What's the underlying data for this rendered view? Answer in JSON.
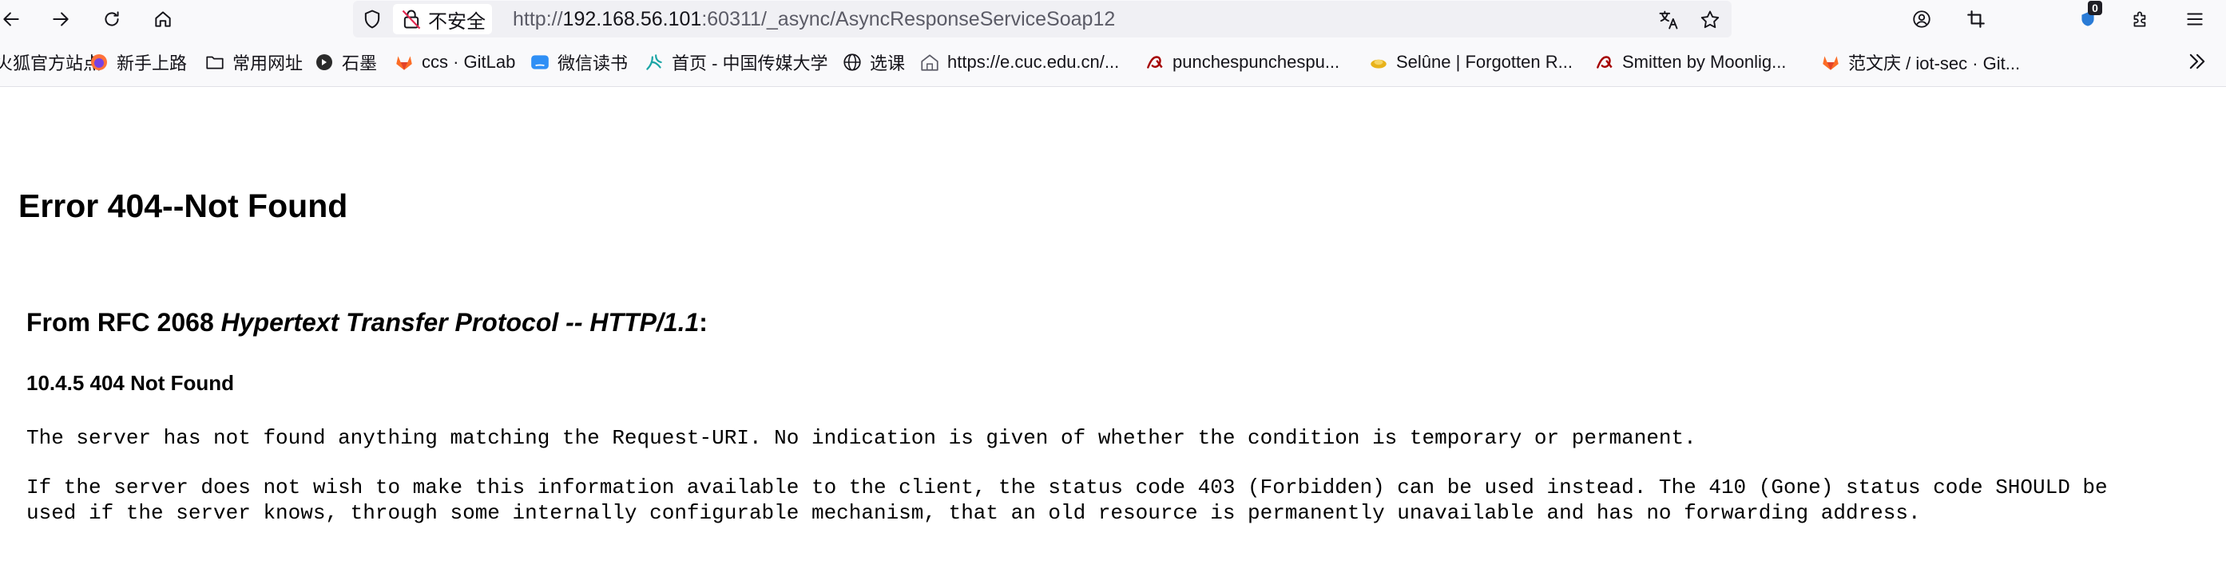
{
  "toolbar": {
    "back_icon": "arrow-left-icon",
    "forward_icon": "arrow-right-icon",
    "reload_icon": "reload-icon",
    "home_icon": "home-icon",
    "security_label": "不安全",
    "url_prefix": "http://",
    "url_host": "192.168.56.101",
    "url_rest": ":60311/_async/AsyncResponseServiceSoap12",
    "translate_icon": "translate-icon",
    "bookmark_star_icon": "star-icon",
    "account_icon": "account-icon",
    "crop_icon": "screenshot-icon",
    "extension_badge": "0",
    "extensions_icon": "puzzle-icon",
    "menu_icon": "hamburger-menu-icon"
  },
  "bookmarks": [
    {
      "label": "火狐官方站点",
      "icon": "firefox-icon"
    },
    {
      "label": "新手上路",
      "icon": "firefox-icon"
    },
    {
      "label": "常用网址",
      "icon": "folder-icon"
    },
    {
      "label": "石墨",
      "icon": "shimo-icon"
    },
    {
      "label": "ccs · GitLab",
      "icon": "gitlab-icon"
    },
    {
      "label": "微信读书",
      "icon": "weread-icon"
    },
    {
      "label": "首页 - 中国传媒大学",
      "icon": "cuc-icon"
    },
    {
      "label": "选课",
      "icon": "globe-icon"
    },
    {
      "label": "https://e.cuc.edu.cn/...",
      "icon": "page-icon"
    },
    {
      "label": "punchespunchespu...",
      "icon": "ao3-icon"
    },
    {
      "label": "Selûne | Forgotten R...",
      "icon": "fandom-icon"
    },
    {
      "label": "Smitten by Moonlig...",
      "icon": "ao3-icon"
    },
    {
      "label": "范文庆 / iot-sec · Git...",
      "icon": "gitlab-icon"
    }
  ],
  "bookmarks_overflow_icon": "chevrons-right-icon",
  "content": {
    "heading": "Error 404--Not Found",
    "rfc_prefix": "From RFC 2068 ",
    "rfc_title": "Hypertext Transfer Protocol -- HTTP/1.1",
    "rfc_suffix": ":",
    "section": "10.4.5 404 Not Found",
    "para1": "The server has not found anything matching the Request-URI. No indication is given of whether the condition is temporary or permanent.",
    "para2": "If the server does not wish to make this information available to the client, the status code 403 (Forbidden) can be used instead. The 410 (Gone) status code SHOULD be used if the server knows, through some internally configurable mechanism, that an old resource is permanently unavailable and has no forwarding address."
  }
}
